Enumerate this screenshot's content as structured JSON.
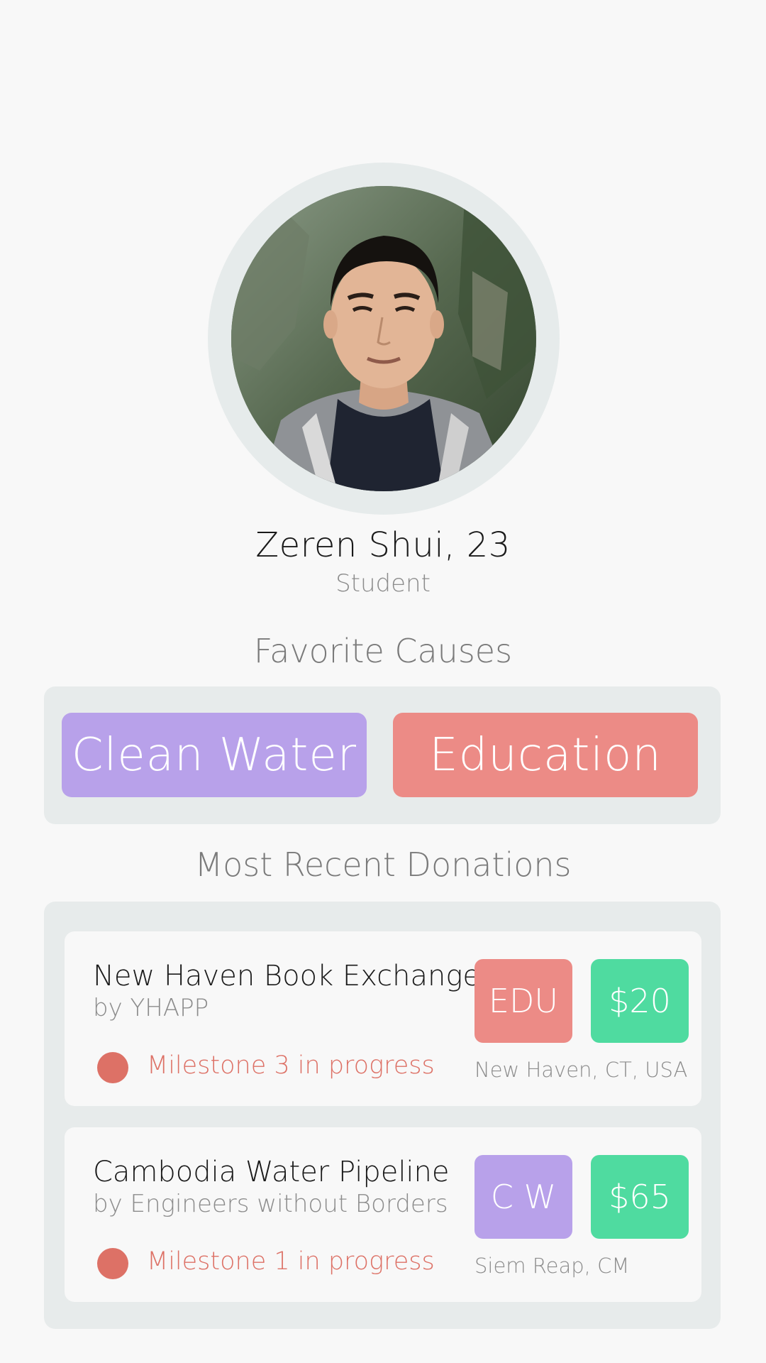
{
  "profile": {
    "name": "Zeren Shui, 23",
    "role": "Student"
  },
  "favorite_causes": {
    "title": "Favorite Causes",
    "items": [
      {
        "label": "Clean Water",
        "color": "#b8a1ea"
      },
      {
        "label": "Education",
        "color": "#ec8b86"
      }
    ]
  },
  "donations": {
    "title": "Most Recent Donations",
    "items": [
      {
        "project": "New Haven Book Exchange",
        "organization": "by YHAPP",
        "status": "Milestone 3 in progress",
        "category_tag": "EDU",
        "amount": "$20",
        "location": "New Haven, CT, USA"
      },
      {
        "project": "Cambodia Water Pipeline",
        "organization": "by Engineers without Borders",
        "status": "Milestone 1 in progress",
        "category_tag": "C W",
        "amount": "$65",
        "location": "Siem Reap, CM"
      }
    ]
  },
  "colors": {
    "background": "#f8f8f8",
    "panel": "#e7ebeb",
    "clean_water": "#b8a1ea",
    "education": "#ec8b86",
    "amount": "#4fdba0",
    "status": "#dd7166"
  }
}
